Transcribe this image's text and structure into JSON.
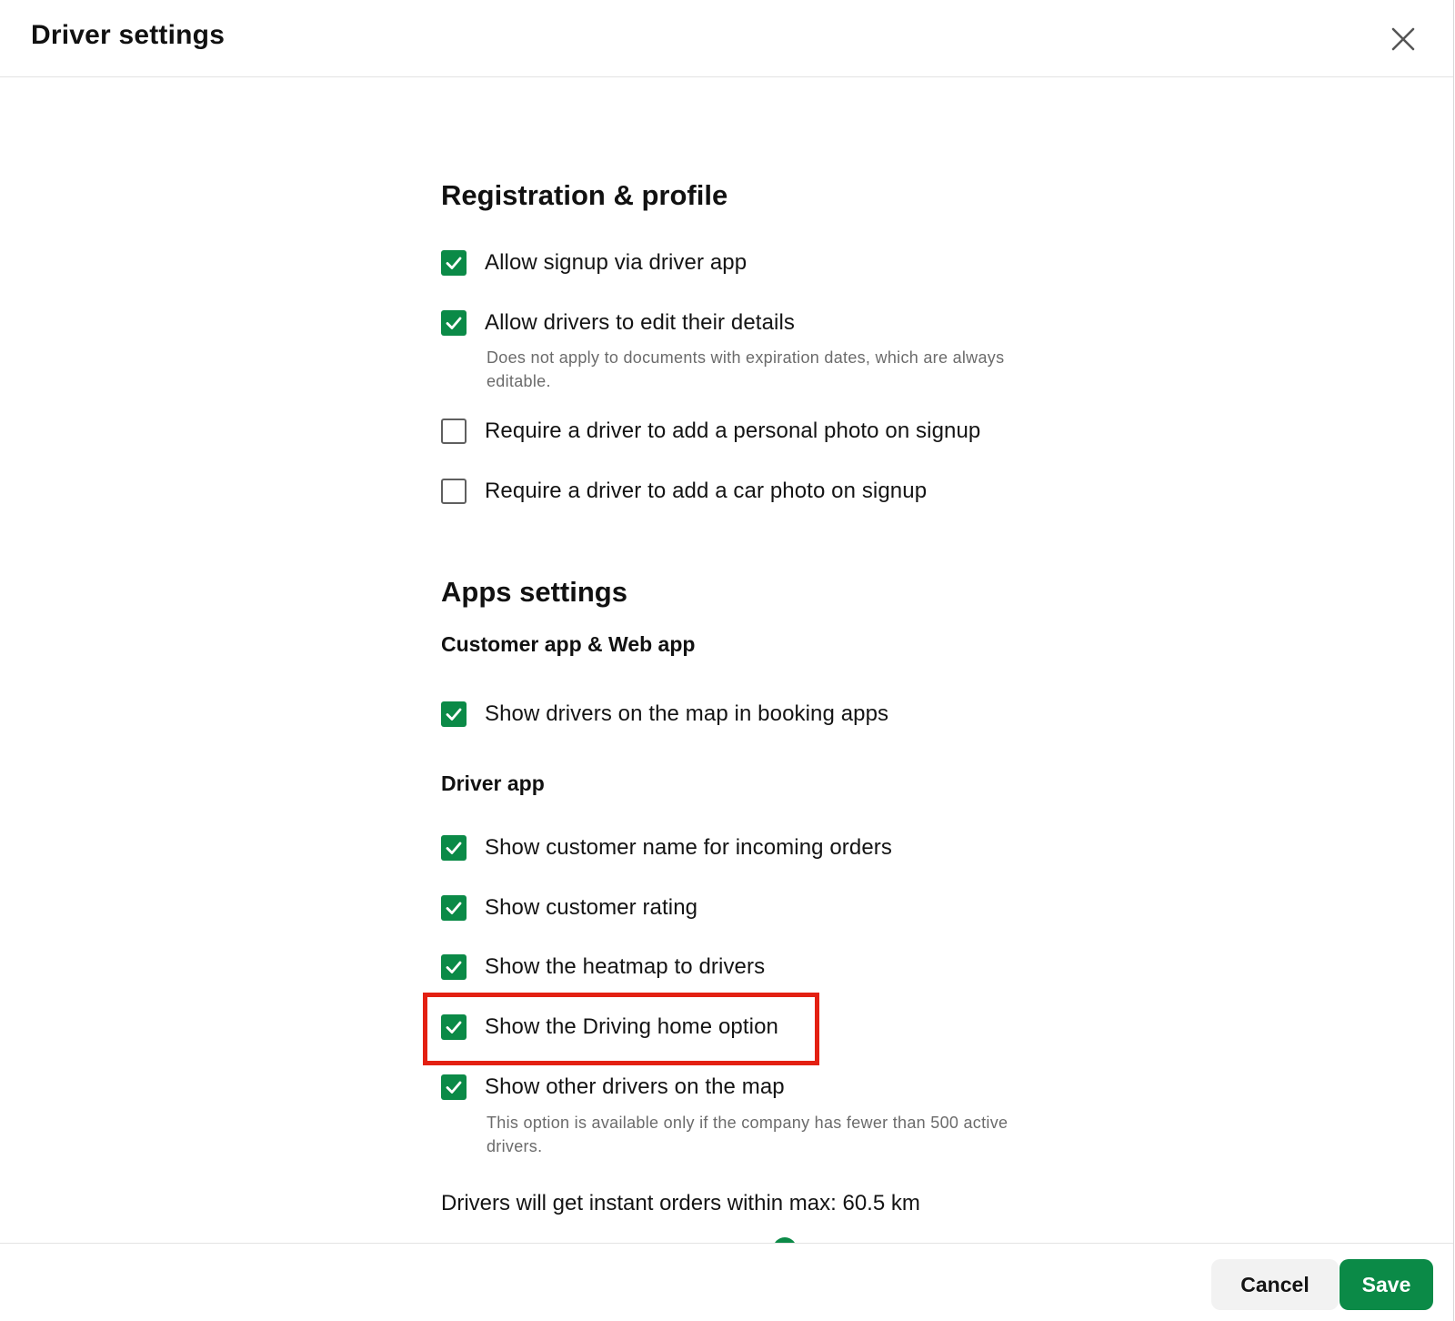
{
  "dialog": {
    "title": "Driver settings"
  },
  "sections": {
    "registration": {
      "title": "Registration & profile",
      "options": [
        {
          "label": "Allow signup via driver app",
          "checked": true
        },
        {
          "label": "Allow drivers to edit their details",
          "checked": true,
          "hint": "Does not apply to documents with expiration dates, which are always editable."
        },
        {
          "label": "Require a driver to add a personal photo on signup",
          "checked": false
        },
        {
          "label": "Require a driver to add a car photo on signup",
          "checked": false
        }
      ]
    },
    "apps": {
      "title": "Apps settings",
      "customer_app": {
        "title": "Customer app & Web app",
        "options": [
          {
            "label": "Show drivers on the map in booking apps",
            "checked": true
          }
        ]
      },
      "driver_app": {
        "title": "Driver app",
        "options": [
          {
            "label": "Show customer name for incoming orders",
            "checked": true
          },
          {
            "label": "Show customer rating",
            "checked": true
          },
          {
            "label": "Show the heatmap to drivers",
            "checked": true
          },
          {
            "label": "Show the Driving home option",
            "checked": true
          },
          {
            "label": "Show other drivers on the map",
            "checked": true,
            "hint": "This option is available only if the company has fewer than 500 active drivers."
          }
        ]
      },
      "instant_orders": {
        "text": "Drivers will get instant orders within max: 60.5 km"
      }
    }
  },
  "footer": {
    "cancel_label": "Cancel",
    "save_label": "Save"
  },
  "colors": {
    "accent": "#0b8a47",
    "highlight": "#e32012"
  }
}
